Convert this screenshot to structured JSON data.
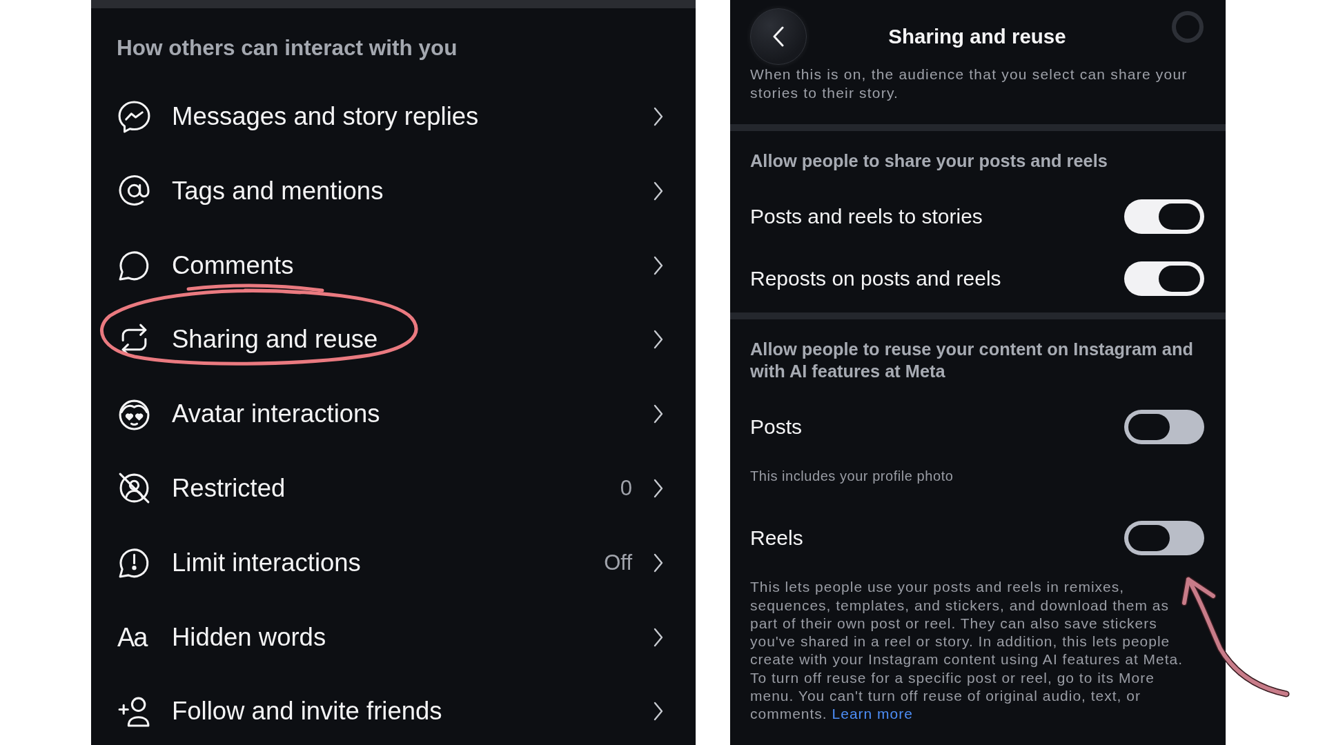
{
  "settings_list": {
    "heading": "How others can interact with you",
    "items": [
      {
        "label": "Messages and story replies",
        "circled": false
      },
      {
        "label": "Tags and mentions",
        "circled": false
      },
      {
        "label": "Comments",
        "circled": false
      },
      {
        "label": "Sharing and reuse",
        "circled": true
      },
      {
        "label": "Avatar interactions",
        "circled": false
      },
      {
        "label": "Restricted",
        "value": "0",
        "circled": false
      },
      {
        "label": "Limit interactions",
        "value": "Off",
        "circled": false
      },
      {
        "label": "Hidden words",
        "glyph": "Aa",
        "circled": false
      },
      {
        "label": "Follow and invite friends",
        "circled": false
      }
    ]
  },
  "detail": {
    "title": "Sharing and reuse",
    "intro": "When this is on, the audience that you select can share your stories to their story.",
    "sections": [
      {
        "heading": "Allow people to share your posts and reels",
        "toggles": [
          {
            "label": "Posts and reels to stories",
            "on": true
          },
          {
            "label": "Reposts on posts and reels",
            "on": true
          }
        ]
      },
      {
        "heading": "Allow people to reuse your content on Instagram and with AI features at Meta",
        "toggles": [
          {
            "label": "Posts",
            "on": false,
            "note": "This includes your profile photo"
          },
          {
            "label": "Reels",
            "on": false,
            "note": "This lets people use your posts and reels in remixes, sequences, templates, and stickers, and download them as part of their own post or reel. They can also save stickers you've shared in a reel or story. In addition, this lets people create with your Instagram content using AI features at Meta. To turn off reuse for a specific post or reel, go to its More menu. You can't turn off reuse of original audio, text, or comments.",
            "link": "Learn more"
          }
        ]
      }
    ]
  }
}
